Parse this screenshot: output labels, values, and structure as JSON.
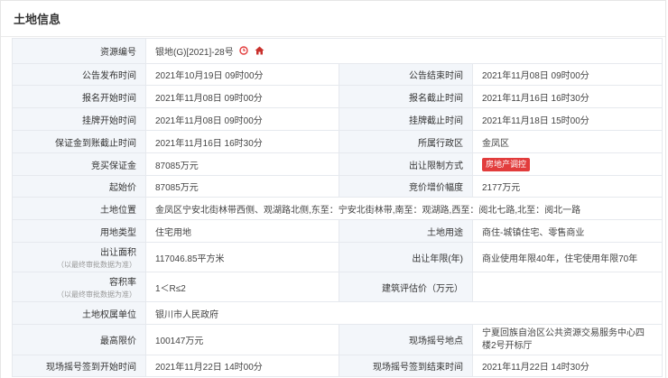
{
  "panel": {
    "title": "土地信息"
  },
  "rows": {
    "resource_no": {
      "label": "资源编号",
      "value": "银地(G)[2021]-28号"
    },
    "announce_start": {
      "label": "公告发布时间",
      "value": "2021年10月19日 09时00分"
    },
    "announce_end": {
      "label": "公告结束时间",
      "value": "2021年11月08日 09时00分"
    },
    "signup_start": {
      "label": "报名开始时间",
      "value": "2021年11月08日 09时00分"
    },
    "signup_end": {
      "label": "报名截止时间",
      "value": "2021年11月16日 16时30分"
    },
    "listing_start": {
      "label": "挂牌开始时间",
      "value": "2021年11月08日 09时00分"
    },
    "listing_end": {
      "label": "挂牌截止时间",
      "value": "2021年11月18日 15时00分"
    },
    "deposit_deadline": {
      "label": "保证金到账截止时间",
      "value": "2021年11月16日 16时30分"
    },
    "district": {
      "label": "所属行政区",
      "value": "金凤区"
    },
    "bid_deposit": {
      "label": "竞买保证金",
      "value": "87085万元"
    },
    "restriction": {
      "label": "出让限制方式",
      "value": "房地产调控"
    },
    "start_price": {
      "label": "起始价",
      "value": "87085万元"
    },
    "increment": {
      "label": "竞价增价幅度",
      "value": "2177万元"
    },
    "location": {
      "label": "土地位置",
      "value": "金凤区宁安北街林带西侧、观湖路北侧,东至：宁安北街林带,南至：观湖路,西至：阅北七路,北至：阅北一路"
    },
    "land_type": {
      "label": "用地类型",
      "value": "住宅用地"
    },
    "land_use": {
      "label": "土地用途",
      "value": "商住-城镇住宅、零售商业"
    },
    "area": {
      "label": "出让面积",
      "sub": "（以最终审批数据为准）",
      "value": "117046.85平方米"
    },
    "term": {
      "label": "出让年限(年)",
      "value": "商业使用年限40年，住宅使用年限70年"
    },
    "plot_ratio": {
      "label": "容积率",
      "sub": "（以最终审批数据为准）",
      "value": "1＜R≤2"
    },
    "building_eval": {
      "label": "建筑评估价（万元）",
      "value": ""
    },
    "owner": {
      "label": "土地权属单位",
      "value": "银川市人民政府"
    },
    "max_price": {
      "label": "最高限价",
      "value": "100147万元"
    },
    "lottery_place": {
      "label": "现场摇号地点",
      "value": "宁夏回族自治区公共资源交易服务中心四楼2号开标厅"
    },
    "lottery_sign_start": {
      "label": "现场摇号签到开始时间",
      "value": "2021年11月22日 14时00分"
    },
    "lottery_sign_end": {
      "label": "现场摇号签到结束时间",
      "value": "2021年11月22日 14时30分"
    }
  },
  "colors": {
    "badge": "#e23c3c",
    "clock_icon": "#e23c3c",
    "home_icon": "#c9302c",
    "label_bg": "#f3f6fa"
  },
  "icons": [
    "clock-icon",
    "home-icon"
  ]
}
